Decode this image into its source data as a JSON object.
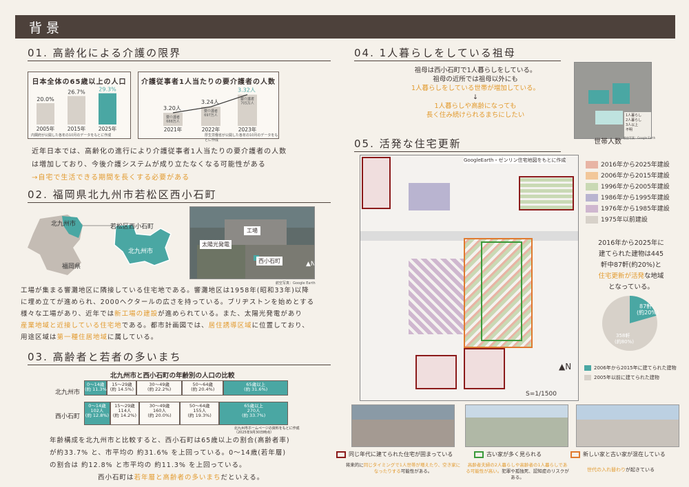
{
  "header": "背景",
  "s01": {
    "title": "01. 高齢化による介護の限界",
    "chart1": {
      "title": "日本全体の65歳以上の人口",
      "note": "内閣府が公開した各年の10月のデータをもとに作成"
    },
    "chart2": {
      "title": "介護従事者1人当たりの要介護者の人数",
      "note": "厚生労働省が公開した各年の10月のデータをもとに作成",
      "sub1": "要介護者\n688万人",
      "sub2": "要介護者\n697万人",
      "sub3": "要介護者\n705万人"
    },
    "text1": "近年日本では、高齢化の進行により介護従事者1人当たりの要介護者の人数",
    "text2": "は増加しており、今後介護システムが成り立たなくなる可能性がある",
    "text3": "→自宅で生活できる期間を長くする必要がある"
  },
  "chart_data": [
    {
      "type": "bar",
      "title": "日本全体の65歳以上の人口",
      "categories": [
        "2005年",
        "2015年",
        "2025年"
      ],
      "values": [
        20.0,
        26.7,
        29.3
      ],
      "value_labels": [
        "20.0%",
        "26.7%",
        "29.3%"
      ]
    },
    {
      "type": "line",
      "title": "介護従事者1人当たりの要介護者の人数",
      "categories": [
        "2021年",
        "2022年",
        "2023年"
      ],
      "values": [
        3.2,
        3.24,
        3.32
      ],
      "value_labels": [
        "3.20人",
        "3.24人",
        "3.32人"
      ]
    }
  ],
  "s02": {
    "title": "02. 福岡県北九州市若松区西小石町",
    "map1": {
      "kitakyushu": "北九州市",
      "fukuoka": "福岡県"
    },
    "map2": {
      "wakamatsu": "若松区西小石町",
      "kitakyushu": "北九州市"
    },
    "aerial": {
      "factory": "工場",
      "solar": "太陽光発電",
      "nishikoishi": "西小石町",
      "credit": "航空写真：Google Earth"
    },
    "p1": "工場が集まる響灘地区に隣接している住宅地である。響灘地区は1958年(昭和33年)以降",
    "p2": "に埋め立てが進められ、2000ヘクタールの広さを持っている。ブリヂストンを始めとする",
    "p3a": "様々な工場があり、近年では",
    "p3b": "新工場の建設",
    "p3c": "が進められている。また、太陽光発電があり",
    "p4a": "産業地域と近接している住宅地",
    "p4b": "である。都市計画図では、",
    "p4c": "居住誘導区域",
    "p4d": "に位置しており、",
    "p5a": "用途区域は",
    "p5b": "第一種住居地域",
    "p5c": "に属している。"
  },
  "s03": {
    "title": "03. 高齢者と若者の多いまち",
    "table_title": "北九州市と西小石町の年齢別の人口の比較",
    "row1": "北九州市",
    "row2": "西小石町",
    "r1": [
      "0～14歳\n(約 11.3%)",
      "15～29歳\n(約 14.5%)",
      "30～49歳\n(約 22.2%)",
      "50～64歳\n(約 20.4%)",
      "65歳以上\n(約 31.6%)"
    ],
    "r2": [
      "0～14歳\n102人\n(約 12.8%)",
      "15～29歳\n114人\n(約 14.2%)",
      "30～49歳\n160人\n(約 20.0%)",
      "50～64歳\n155人\n(約 19.3%)",
      "65歳以上\n270人\n(約 33.7%)"
    ],
    "source": "北九州市ホームページの資料をもとに作成\n（2025年9月30日時点）",
    "t1": "年齢構成を北九州市と比較すると、西小石町は65歳以上の割合(高齢者率)",
    "t2": "が約33.7% と、市平均の 約31.6% を上回っている。0～14歳(若年層)",
    "t3": "の割合は 約12.8% と市平均の 約11.3% を上回っている。",
    "t4a": "西小石町は",
    "t4b": "若年層と高齢者の多いまち",
    "t4c": "だといえる。"
  },
  "s04": {
    "title": "04. 1人暮らしをしている祖母",
    "l1": "祖母は西小石町で1人暮らしをしている。",
    "l2": "祖母の近所では祖母以外にも",
    "l3": "1人暮らしをしている世帯が増加している。",
    "arrow": "↓",
    "l4": "1人暮らしや高齢になっても",
    "l5": "長く住み続けられるまちにしたい",
    "map_caption": "世帯人数",
    "legend": [
      "1人暮らし",
      "2人暮らし",
      "3人以上",
      "不明"
    ],
    "credit": "航空写真：Google Earth"
  },
  "s05": {
    "title": "05. 活発な住宅更新",
    "map_credit": "GoogleEarth・ゼンリン住宅地図をもとに作成",
    "scale": "S=1/1500",
    "legend": [
      "2016年から2025年建設",
      "2006年から2015年建設",
      "1996年から2005年建設",
      "1986年から1995年建設",
      "1976年から1985年建設",
      "1975年以前建設"
    ],
    "legend_colors": [
      "#e8b4a4",
      "#f2c79a",
      "#c9d9b4",
      "#b9b4d0",
      "#cfb7cf",
      "#d7d1c9"
    ],
    "desc1": "2016年から2025年に",
    "desc2": "建てられた建物は445",
    "desc3": "軒中87軒(約20%)と",
    "desc4a": "住宅更新が活発",
    "desc4b": "な地域",
    "desc5": "となっている。",
    "pie1": "87軒",
    "pie1b": "(約20%)",
    "pie2": "358軒",
    "pie2b": "(約80%)",
    "pie_leg1": "2006年から2015年に建てられた建物",
    "pie_leg2": "2005年以前に建てられた建物",
    "c1": "同じ年代に建てられた住宅が固まっている",
    "c2": "古い家が多く見られる",
    "c3": "新しい家と古い家が混在している",
    "n1a": "将来的に",
    "n1b": "同じタイミングで1人世帯が増えたり、空き家になったりする",
    "n1c": "可能性がある。",
    "n2a": "高齢者夫婦の2人暮らしや高齢者の1人暮らしである可能性が高い。",
    "n2b": "犯罪や孤独死、認知症のリスクがある。",
    "n3a": "世代の入れ替わり",
    "n3b": "が起きている"
  }
}
